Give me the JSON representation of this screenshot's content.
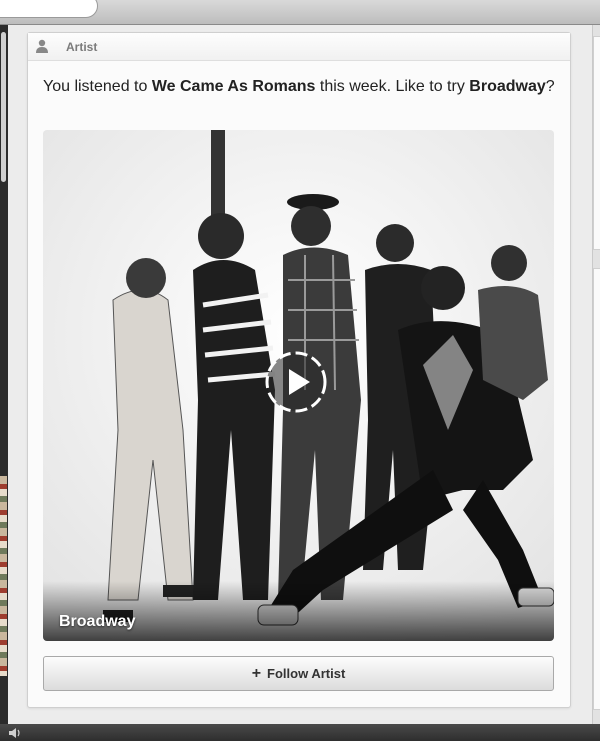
{
  "card": {
    "header_label": "Artist",
    "message": {
      "prefix": "You listened to ",
      "listened_artist": "We Came As Romans",
      "middle": " this week. Like to try ",
      "suggested_artist": "Broadway",
      "suffix": "?"
    },
    "photo_caption": "Broadway",
    "follow_button_label": "Follow Artist"
  },
  "icons": {
    "header": "person-icon",
    "play": "play-icon",
    "follow": "plus-icon",
    "volume": "volume-icon"
  },
  "colors": {
    "card_background": "#fbfbfb",
    "app_background": "#3a3a3a"
  }
}
